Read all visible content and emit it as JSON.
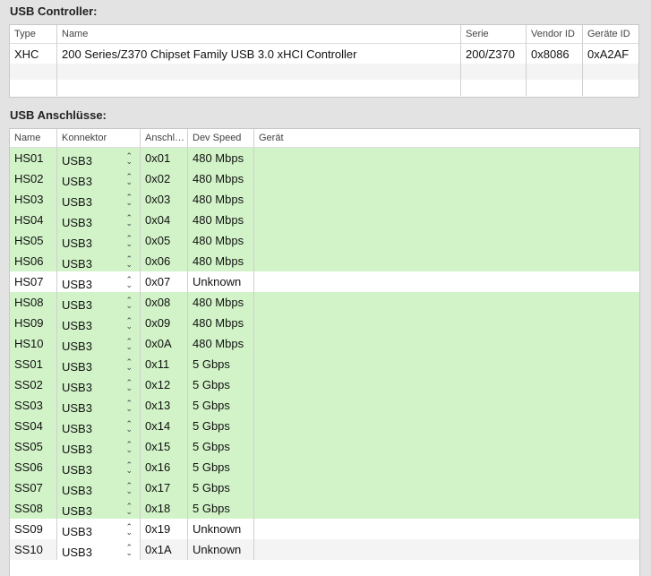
{
  "controller": {
    "title": "USB Controller:",
    "columns": [
      "Type",
      "Name",
      "Serie",
      "Vendor ID",
      "Geräte ID"
    ],
    "rows": [
      {
        "type": "XHC",
        "name": "200 Series/Z370 Chipset Family USB 3.0 xHCI Controller",
        "serie": "200/Z370",
        "vendor": "0x8086",
        "device": "0xA2AF"
      }
    ]
  },
  "ports": {
    "title": "USB Anschlüsse:",
    "columns": [
      "Name",
      "Konnektor",
      "Anschl…",
      "Dev Speed",
      "Gerät"
    ],
    "rows": [
      {
        "name": "HS01",
        "conn": "USB3",
        "port": "0x01",
        "speed": "480 Mbps",
        "device": "",
        "active": true
      },
      {
        "name": "HS02",
        "conn": "USB3",
        "port": "0x02",
        "speed": "480 Mbps",
        "device": "",
        "active": true
      },
      {
        "name": "HS03",
        "conn": "USB3",
        "port": "0x03",
        "speed": "480 Mbps",
        "device": "",
        "active": true
      },
      {
        "name": "HS04",
        "conn": "USB3",
        "port": "0x04",
        "speed": "480 Mbps",
        "device": "",
        "active": true
      },
      {
        "name": "HS05",
        "conn": "USB3",
        "port": "0x05",
        "speed": "480 Mbps",
        "device": "",
        "active": true
      },
      {
        "name": "HS06",
        "conn": "USB3",
        "port": "0x06",
        "speed": "480 Mbps",
        "device": "",
        "active": true
      },
      {
        "name": "HS07",
        "conn": "USB3",
        "port": "0x07",
        "speed": "Unknown",
        "device": "",
        "active": false
      },
      {
        "name": "HS08",
        "conn": "USB3",
        "port": "0x08",
        "speed": "480 Mbps",
        "device": "",
        "active": true
      },
      {
        "name": "HS09",
        "conn": "USB3",
        "port": "0x09",
        "speed": "480 Mbps",
        "device": "",
        "active": true
      },
      {
        "name": "HS10",
        "conn": "USB3",
        "port": "0x0A",
        "speed": "480 Mbps",
        "device": "",
        "active": true
      },
      {
        "name": "SS01",
        "conn": "USB3",
        "port": "0x11",
        "speed": "5 Gbps",
        "device": "",
        "active": true
      },
      {
        "name": "SS02",
        "conn": "USB3",
        "port": "0x12",
        "speed": "5 Gbps",
        "device": "",
        "active": true
      },
      {
        "name": "SS03",
        "conn": "USB3",
        "port": "0x13",
        "speed": "5 Gbps",
        "device": "",
        "active": true
      },
      {
        "name": "SS04",
        "conn": "USB3",
        "port": "0x14",
        "speed": "5 Gbps",
        "device": "",
        "active": true
      },
      {
        "name": "SS05",
        "conn": "USB3",
        "port": "0x15",
        "speed": "5 Gbps",
        "device": "",
        "active": true
      },
      {
        "name": "SS06",
        "conn": "USB3",
        "port": "0x16",
        "speed": "5 Gbps",
        "device": "",
        "active": true
      },
      {
        "name": "SS07",
        "conn": "USB3",
        "port": "0x17",
        "speed": "5 Gbps",
        "device": "",
        "active": true
      },
      {
        "name": "SS08",
        "conn": "USB3",
        "port": "0x18",
        "speed": "5 Gbps",
        "device": "",
        "active": true
      },
      {
        "name": "SS09",
        "conn": "USB3",
        "port": "0x19",
        "speed": "Unknown",
        "device": "",
        "active": false
      },
      {
        "name": "SS10",
        "conn": "USB3",
        "port": "0x1A",
        "speed": "Unknown",
        "device": "",
        "active": false
      }
    ]
  },
  "colors": {
    "active": "#d2f3c8"
  }
}
